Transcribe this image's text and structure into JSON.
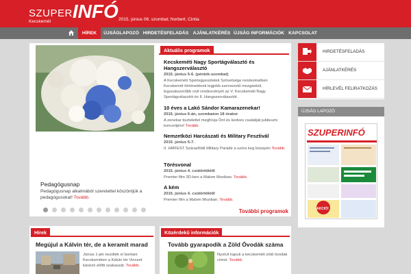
{
  "header": {
    "logo_part1": "SZUPER",
    "logo_part2": "INFÓ",
    "city": "Kecskemét",
    "dateline": "2015. június 06. szombat; Norbert, Cintia"
  },
  "nav": {
    "items": [
      "HÍREK",
      "ÚJSÁGLAPOZÓ",
      "HIRDETÉSFELADÁS",
      "AJÁNLATKÉRÉS",
      "ÚJSÁG INFORMÁCIÓK",
      "KAPCSOLAT"
    ],
    "active": "HÍREK"
  },
  "featured": {
    "title": "Pedagógusnap",
    "text": "Pedagógusnap alkalmából szeretettel köszöntjük a pedagógusokat!",
    "more": "Tovább.",
    "slides_count": 12
  },
  "programs": {
    "heading": "Aktuális programok",
    "items": [
      {
        "title": "Kecskeméti Nagy Sportágválasztó és Hangszerválasztó",
        "date": "2015. június 5-6. (péntek-szombat)",
        "text": "A Kecskeméti Sportegyesületek Szövetsége rendezésében Kecskemét történetének legjobb szervezetű mozgásból, legszakszerűbb civil rendezvényét az V. Kecskeméti Nagy Sportágválasztót és II. Hangszerválasztót.",
        "more": ""
      },
      {
        "title": "10 éves a Lakó Sándor Kamarazenekar!",
        "date": "2015. június 6-án, szombaton 18 órakor",
        "text": "A zenekar tisztelettel meghívja Önt és kedves családját jubileumi koncertjére!",
        "more": "Tovább."
      },
      {
        "title": "Nemzetközi Harcászati és Military Fesztivál",
        "date": "2015. június 5-7.",
        "text": "II. HMFEST Szárazföldi Military Parádé a szóra keg közepén",
        "more": "Tovább."
      },
      {
        "title": "Törésvonal",
        "date": "2015. június 4. csütörtöktől",
        "text": "Premier film 3D-ben a Malom Moziban.",
        "more": "Tovább."
      },
      {
        "title": "A kém",
        "date": "2015. június 4. csütörtöktől",
        "text": "Premier film a Malom Moziban.",
        "more": "Tovább."
      }
    ],
    "all_link": "További programok"
  },
  "side_menu": [
    {
      "label": "HIRDETÉSFELADÁS",
      "icon": "document-arrow-icon"
    },
    {
      "label": "AJÁNLATKÉRÉS",
      "icon": "handshake-icon"
    },
    {
      "label": "HÍRLEVÉL FELIRATKOZÁS",
      "icon": "envelope-icon"
    }
  ],
  "lapozo": {
    "heading": "ÚJSÁG LAPOZÓ",
    "cover_logo": "SZUPERINFÓ",
    "cover_badge": "AKCIÓ!"
  },
  "news": {
    "heading": "Hírek",
    "title": "Megújul a Kálvin tér, de a keramit marad",
    "text": "Június 1-jén kezdték el bontani Kecskeméten a Kálvin tér Vincent kávézó előtti szakaszát.",
    "more": "Tovább."
  },
  "public": {
    "heading": "Közérdekű információk",
    "title": "Tovább gyarapodik a Zöld Óvodák száma",
    "text": "Nyolclt kapuk a kecskeméti zöld óvodák címet.",
    "more": "Tovább."
  },
  "colors": {
    "brand_red": "#d61f26",
    "nav_gray": "#6e6e6e",
    "page_bg": "#d9d9d9"
  }
}
